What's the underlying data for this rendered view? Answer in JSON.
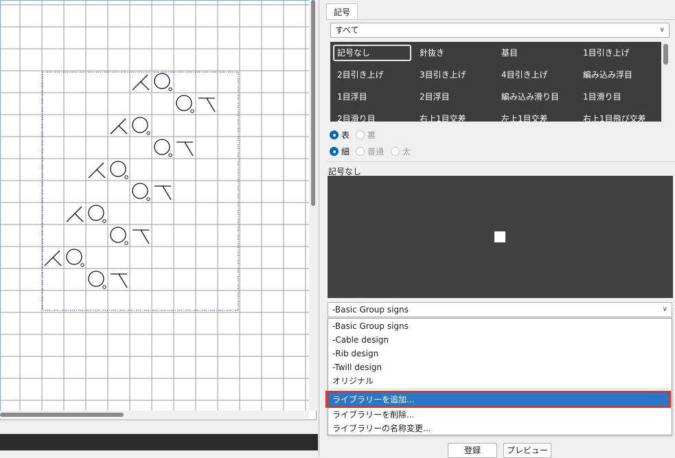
{
  "tab": {
    "label": "記号"
  },
  "category_select": {
    "value": "すべて"
  },
  "symbol_list": [
    [
      "記号なし",
      "針抜き",
      "基目",
      "1目引き上げ"
    ],
    [
      "2目引き上げ",
      "3目引き上げ",
      "4目引き上げ",
      "編み込み浮目"
    ],
    [
      "1目浮目",
      "2目浮目",
      "編み込み滑り目",
      "1目滑り目"
    ],
    [
      "2目滑り目",
      "右上1目交差",
      "左上1目交差",
      "右上1目飛び交差"
    ]
  ],
  "radio_face": {
    "front": "表",
    "back": "裏"
  },
  "radio_weight": {
    "thin": "細",
    "normal": "普通",
    "thick": "太"
  },
  "preview": {
    "title": "記号なし"
  },
  "library_select": {
    "value": "-Basic Group signs"
  },
  "library_options": [
    "-Basic Group signs",
    "-Cable design",
    "-Rib design",
    "-Twill design",
    "オリジナル"
  ],
  "library_actions": [
    "ライブラリーを追加...",
    "ライブラリーを削除...",
    "ライブラリーの名称変更..."
  ],
  "buttons": {
    "register": "登録",
    "preview": "プレビュー"
  },
  "colors": {
    "accent": "#0067c0",
    "highlight": "#2a78c5",
    "callout": "#e8321e",
    "dark_panel": "#3c3c3c"
  }
}
